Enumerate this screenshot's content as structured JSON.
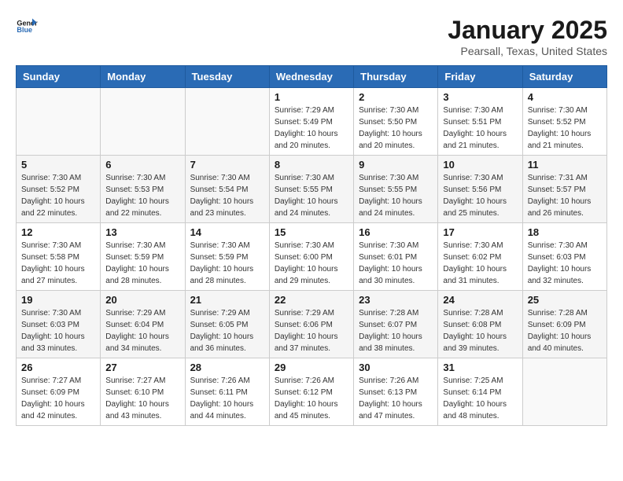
{
  "logo": {
    "line1": "General",
    "line2": "Blue"
  },
  "title": "January 2025",
  "subtitle": "Pearsall, Texas, United States",
  "weekdays": [
    "Sunday",
    "Monday",
    "Tuesday",
    "Wednesday",
    "Thursday",
    "Friday",
    "Saturday"
  ],
  "rows": [
    [
      {
        "day": "",
        "sunrise": "",
        "sunset": "",
        "daylight": "",
        "empty": true
      },
      {
        "day": "",
        "sunrise": "",
        "sunset": "",
        "daylight": "",
        "empty": true
      },
      {
        "day": "",
        "sunrise": "",
        "sunset": "",
        "daylight": "",
        "empty": true
      },
      {
        "day": "1",
        "sunrise": "Sunrise: 7:29 AM",
        "sunset": "Sunset: 5:49 PM",
        "daylight": "Daylight: 10 hours and 20 minutes."
      },
      {
        "day": "2",
        "sunrise": "Sunrise: 7:30 AM",
        "sunset": "Sunset: 5:50 PM",
        "daylight": "Daylight: 10 hours and 20 minutes."
      },
      {
        "day": "3",
        "sunrise": "Sunrise: 7:30 AM",
        "sunset": "Sunset: 5:51 PM",
        "daylight": "Daylight: 10 hours and 21 minutes."
      },
      {
        "day": "4",
        "sunrise": "Sunrise: 7:30 AM",
        "sunset": "Sunset: 5:52 PM",
        "daylight": "Daylight: 10 hours and 21 minutes."
      }
    ],
    [
      {
        "day": "5",
        "sunrise": "Sunrise: 7:30 AM",
        "sunset": "Sunset: 5:52 PM",
        "daylight": "Daylight: 10 hours and 22 minutes."
      },
      {
        "day": "6",
        "sunrise": "Sunrise: 7:30 AM",
        "sunset": "Sunset: 5:53 PM",
        "daylight": "Daylight: 10 hours and 22 minutes."
      },
      {
        "day": "7",
        "sunrise": "Sunrise: 7:30 AM",
        "sunset": "Sunset: 5:54 PM",
        "daylight": "Daylight: 10 hours and 23 minutes."
      },
      {
        "day": "8",
        "sunrise": "Sunrise: 7:30 AM",
        "sunset": "Sunset: 5:55 PM",
        "daylight": "Daylight: 10 hours and 24 minutes."
      },
      {
        "day": "9",
        "sunrise": "Sunrise: 7:30 AM",
        "sunset": "Sunset: 5:55 PM",
        "daylight": "Daylight: 10 hours and 24 minutes."
      },
      {
        "day": "10",
        "sunrise": "Sunrise: 7:30 AM",
        "sunset": "Sunset: 5:56 PM",
        "daylight": "Daylight: 10 hours and 25 minutes."
      },
      {
        "day": "11",
        "sunrise": "Sunrise: 7:31 AM",
        "sunset": "Sunset: 5:57 PM",
        "daylight": "Daylight: 10 hours and 26 minutes."
      }
    ],
    [
      {
        "day": "12",
        "sunrise": "Sunrise: 7:30 AM",
        "sunset": "Sunset: 5:58 PM",
        "daylight": "Daylight: 10 hours and 27 minutes."
      },
      {
        "day": "13",
        "sunrise": "Sunrise: 7:30 AM",
        "sunset": "Sunset: 5:59 PM",
        "daylight": "Daylight: 10 hours and 28 minutes."
      },
      {
        "day": "14",
        "sunrise": "Sunrise: 7:30 AM",
        "sunset": "Sunset: 5:59 PM",
        "daylight": "Daylight: 10 hours and 28 minutes."
      },
      {
        "day": "15",
        "sunrise": "Sunrise: 7:30 AM",
        "sunset": "Sunset: 6:00 PM",
        "daylight": "Daylight: 10 hours and 29 minutes."
      },
      {
        "day": "16",
        "sunrise": "Sunrise: 7:30 AM",
        "sunset": "Sunset: 6:01 PM",
        "daylight": "Daylight: 10 hours and 30 minutes."
      },
      {
        "day": "17",
        "sunrise": "Sunrise: 7:30 AM",
        "sunset": "Sunset: 6:02 PM",
        "daylight": "Daylight: 10 hours and 31 minutes."
      },
      {
        "day": "18",
        "sunrise": "Sunrise: 7:30 AM",
        "sunset": "Sunset: 6:03 PM",
        "daylight": "Daylight: 10 hours and 32 minutes."
      }
    ],
    [
      {
        "day": "19",
        "sunrise": "Sunrise: 7:30 AM",
        "sunset": "Sunset: 6:03 PM",
        "daylight": "Daylight: 10 hours and 33 minutes."
      },
      {
        "day": "20",
        "sunrise": "Sunrise: 7:29 AM",
        "sunset": "Sunset: 6:04 PM",
        "daylight": "Daylight: 10 hours and 34 minutes."
      },
      {
        "day": "21",
        "sunrise": "Sunrise: 7:29 AM",
        "sunset": "Sunset: 6:05 PM",
        "daylight": "Daylight: 10 hours and 36 minutes."
      },
      {
        "day": "22",
        "sunrise": "Sunrise: 7:29 AM",
        "sunset": "Sunset: 6:06 PM",
        "daylight": "Daylight: 10 hours and 37 minutes."
      },
      {
        "day": "23",
        "sunrise": "Sunrise: 7:28 AM",
        "sunset": "Sunset: 6:07 PM",
        "daylight": "Daylight: 10 hours and 38 minutes."
      },
      {
        "day": "24",
        "sunrise": "Sunrise: 7:28 AM",
        "sunset": "Sunset: 6:08 PM",
        "daylight": "Daylight: 10 hours and 39 minutes."
      },
      {
        "day": "25",
        "sunrise": "Sunrise: 7:28 AM",
        "sunset": "Sunset: 6:09 PM",
        "daylight": "Daylight: 10 hours and 40 minutes."
      }
    ],
    [
      {
        "day": "26",
        "sunrise": "Sunrise: 7:27 AM",
        "sunset": "Sunset: 6:09 PM",
        "daylight": "Daylight: 10 hours and 42 minutes."
      },
      {
        "day": "27",
        "sunrise": "Sunrise: 7:27 AM",
        "sunset": "Sunset: 6:10 PM",
        "daylight": "Daylight: 10 hours and 43 minutes."
      },
      {
        "day": "28",
        "sunrise": "Sunrise: 7:26 AM",
        "sunset": "Sunset: 6:11 PM",
        "daylight": "Daylight: 10 hours and 44 minutes."
      },
      {
        "day": "29",
        "sunrise": "Sunrise: 7:26 AM",
        "sunset": "Sunset: 6:12 PM",
        "daylight": "Daylight: 10 hours and 45 minutes."
      },
      {
        "day": "30",
        "sunrise": "Sunrise: 7:26 AM",
        "sunset": "Sunset: 6:13 PM",
        "daylight": "Daylight: 10 hours and 47 minutes."
      },
      {
        "day": "31",
        "sunrise": "Sunrise: 7:25 AM",
        "sunset": "Sunset: 6:14 PM",
        "daylight": "Daylight: 10 hours and 48 minutes."
      },
      {
        "day": "",
        "sunrise": "",
        "sunset": "",
        "daylight": "",
        "empty": true
      }
    ]
  ]
}
